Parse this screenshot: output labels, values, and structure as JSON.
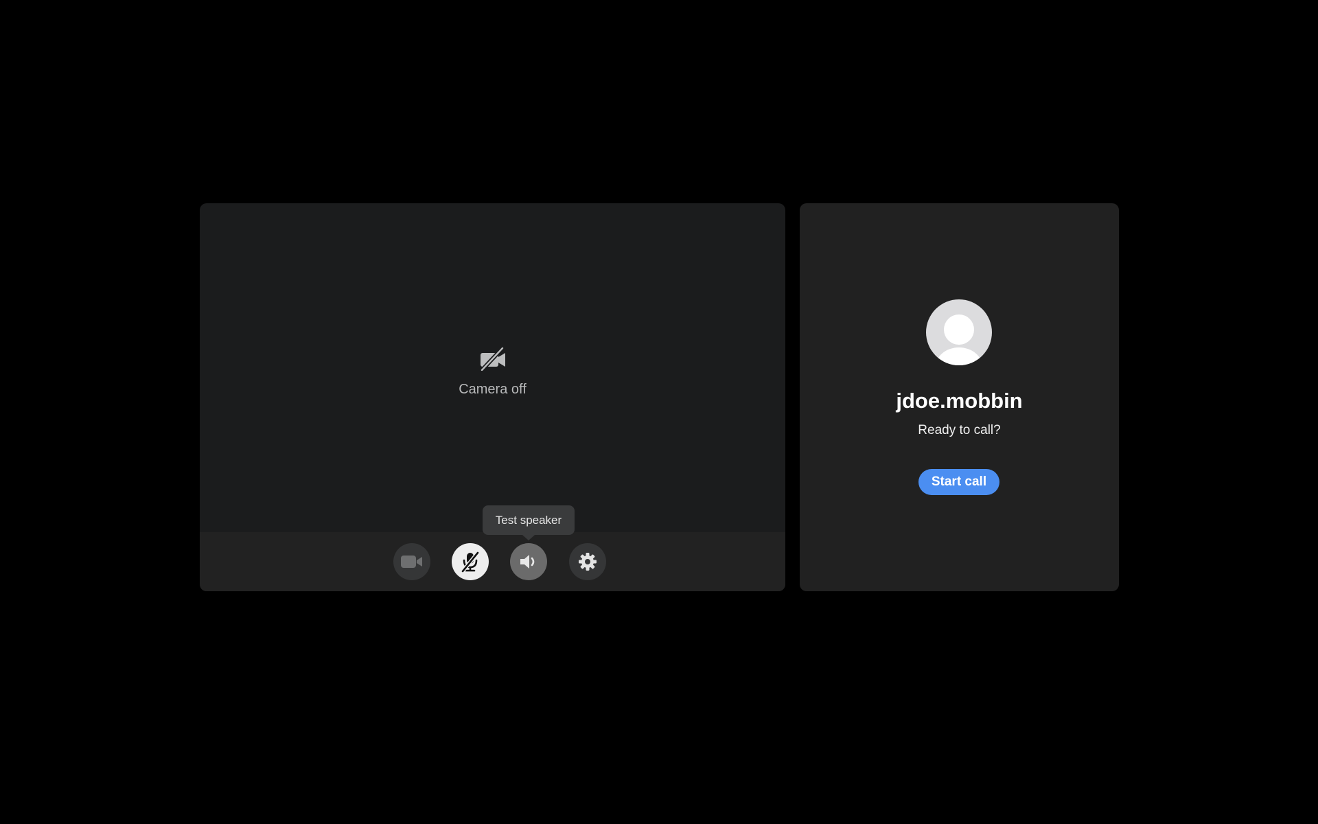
{
  "preview": {
    "camera_status_icon": "camera-off-icon",
    "camera_status_label": "Camera off"
  },
  "controls": {
    "video_icon": "video-camera-icon",
    "mic_icon": "microphone-muted-icon",
    "speaker_icon": "speaker-icon",
    "settings_icon": "gear-icon",
    "mic_muted": true
  },
  "tooltip": {
    "text": "Test speaker"
  },
  "contact": {
    "avatar_icon": "person-avatar-icon",
    "name": "jdoe.mobbin",
    "status": "Ready to call?",
    "start_call_label": "Start call"
  },
  "colors": {
    "background": "#000000",
    "panel": "#1b1c1d",
    "accent": "#4b8ef1"
  }
}
